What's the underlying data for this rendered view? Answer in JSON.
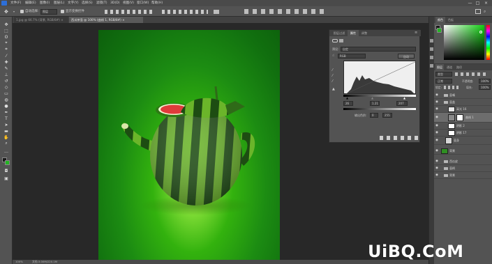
{
  "menu": {
    "items": [
      "文件(F)",
      "编辑(E)",
      "图像(I)",
      "图层(L)",
      "文字(Y)",
      "选择(S)",
      "滤镜(T)",
      "3D(D)",
      "视图(V)",
      "窗口(W)",
      "帮助(H)"
    ],
    "window_controls": [
      "—",
      "□",
      "×"
    ]
  },
  "options_bar": {
    "auto_select_label": "自动选择:",
    "auto_select_value": "图层",
    "transform_label": "显示变换控件"
  },
  "tabs": [
    {
      "label": "1.jpg @ 66.7% (背景, RGB/8#) ×"
    },
    {
      "label": "西瓜茶壶 @ 100% (曲线 1, RGB/8#) × "
    }
  ],
  "properties": {
    "tabs": [
      "图层过滤",
      "属性",
      "调整"
    ],
    "section_icon": "curves-icon",
    "preset_label": "预设:",
    "preset_value": "自定",
    "channel_value": "RGB",
    "auto_button": "自动",
    "input_values": [
      "26",
      "1.21",
      "207"
    ],
    "output_label": "输出色阶:",
    "output_values": [
      "0",
      "255"
    ]
  },
  "color_panel": {
    "tabs": [
      "颜色",
      "色板"
    ],
    "accent": "#1ec81e"
  },
  "layers_panel": {
    "tabs": [
      "图层",
      "通道",
      "路径"
    ],
    "kind_label": "类型",
    "blend_mode": "正常",
    "opacity_label": "不透明度:",
    "opacity_value": "100%",
    "lock_label": "锁定:",
    "fill_label": "填充:",
    "fill_value": "100%",
    "layers": [
      {
        "name": "壶嘴",
        "kind": "group"
      },
      {
        "name": "壶盖",
        "kind": "group"
      },
      {
        "name": "高光 16",
        "kind": "layer"
      },
      {
        "name": "曲线 1",
        "kind": "adjustment"
      },
      {
        "name": "阴影 2",
        "kind": "layer"
      },
      {
        "name": "阴影 17",
        "kind": "layer"
      },
      {
        "name": "壶身",
        "kind": "layer"
      },
      {
        "name": "背景",
        "kind": "layer"
      },
      {
        "name": "西瓜皮",
        "kind": "group"
      },
      {
        "name": "壶柄",
        "kind": "group"
      },
      {
        "name": "背景",
        "kind": "group"
      }
    ]
  },
  "status": {
    "zoom": "100%",
    "doc_info": "文档:3.00M/220.1M"
  },
  "watermark": "UiBQ.CoM"
}
